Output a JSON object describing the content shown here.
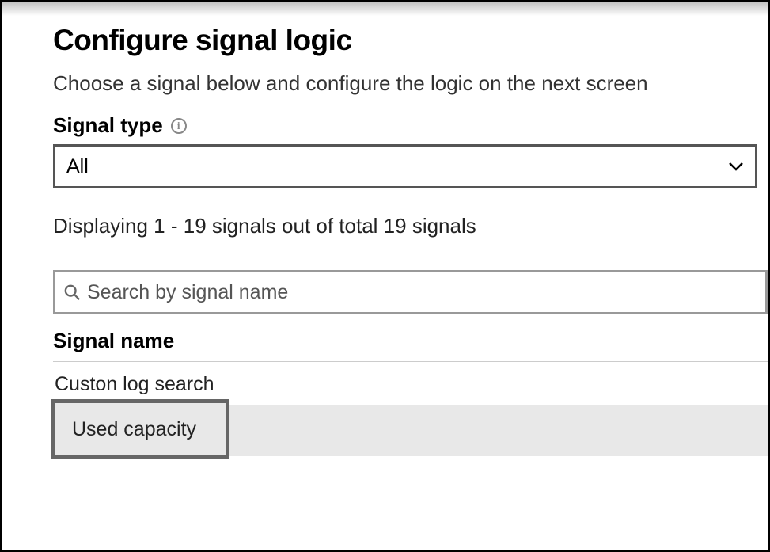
{
  "header": {
    "title": "Configure signal logic",
    "subtitle": "Choose a signal below and configure the logic on the next screen"
  },
  "signal_type": {
    "label": "Signal type",
    "selected": "All"
  },
  "status": "Displaying 1 - 19 signals out of total 19 signals",
  "search": {
    "placeholder": "Search by signal name"
  },
  "list": {
    "column_header": "Signal name",
    "rows": [
      {
        "label": "Custon log search",
        "selected": false
      },
      {
        "label": "Used capacity",
        "selected": true
      }
    ]
  }
}
